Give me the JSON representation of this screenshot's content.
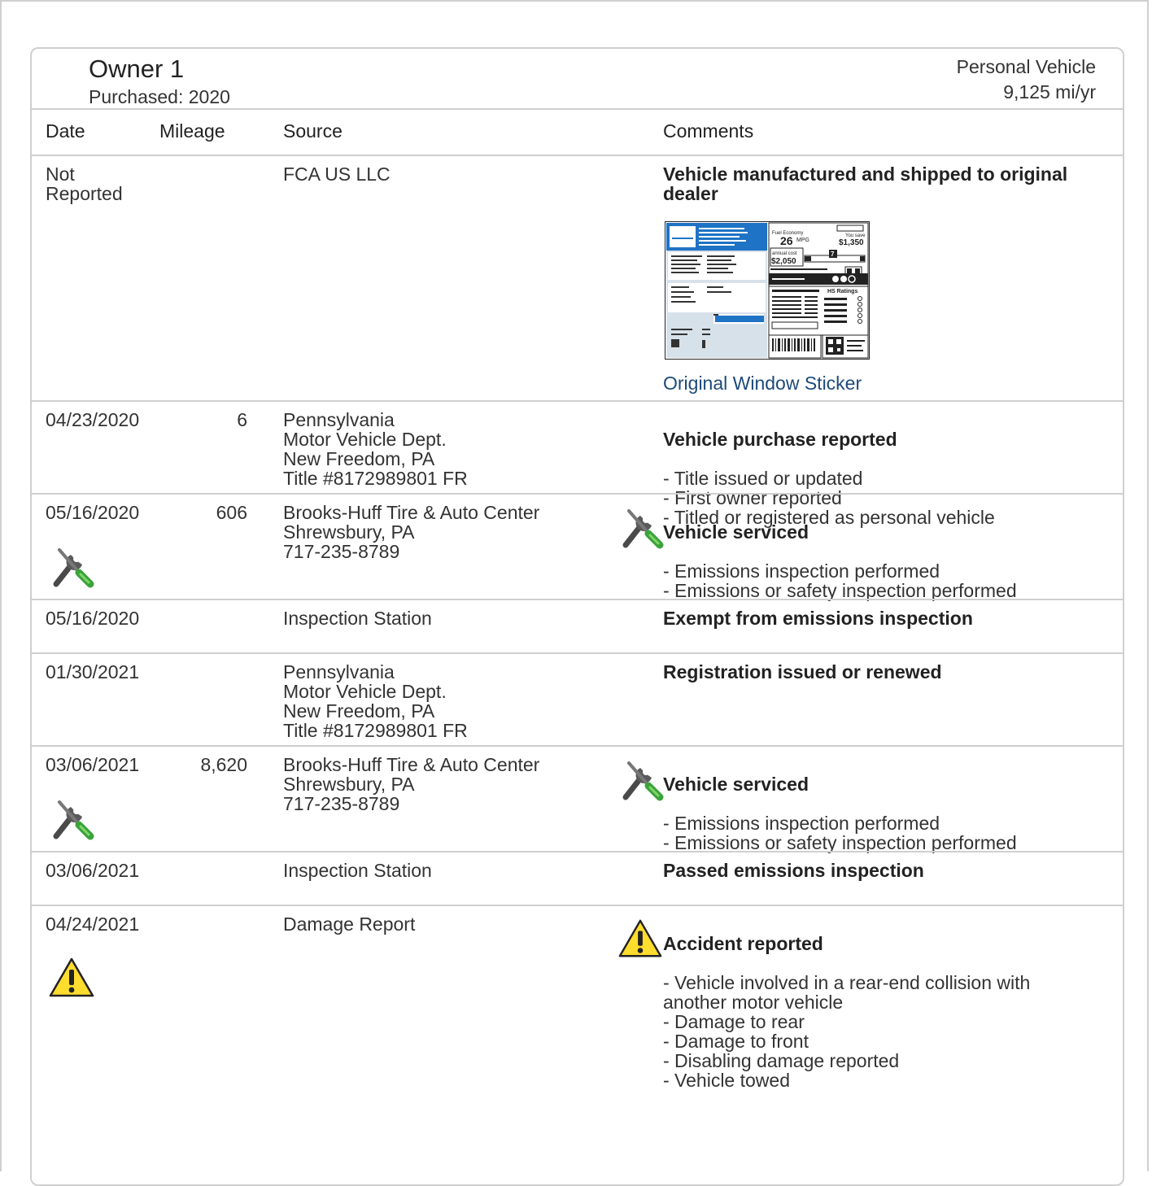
{
  "owner": {
    "title": "Owner 1",
    "purchased": "Purchased: 2020",
    "vehicle_type": "Personal Vehicle",
    "mileage_per_year": "9,125 mi/yr"
  },
  "columns": {
    "date": "Date",
    "mileage": "Mileage",
    "source": "Source",
    "comments": "Comments"
  },
  "sticker": {
    "link_label": "Original Window Sticker",
    "mpg": "26",
    "mpg_unit": "MPG",
    "you_save_label": "You save",
    "save_amount": "$1,350",
    "annual_cost_label": "annual cost",
    "annual_cost": "$2,050",
    "score": "7",
    "ratings_label": "HS Ratings"
  },
  "rows": [
    {
      "date": "Not\nReported",
      "mileage": "",
      "source": "FCA US LLC",
      "comment_title": "Vehicle manufactured and shipped to original dealer",
      "comment_lines": ""
    },
    {
      "date": "04/23/2020",
      "mileage": "6",
      "source": "Pennsylvania\nMotor Vehicle Dept.\nNew Freedom, PA\nTitle #8172989801 FR",
      "comment_title": "Vehicle purchase reported",
      "comment_lines": "- Title issued or updated\n- First owner reported\n- Titled or registered as personal vehicle"
    },
    {
      "date": "05/16/2020",
      "mileage": "606",
      "source": "Brooks-Huff Tire & Auto Center\nShrewsbury, PA\n717-235-8789",
      "comment_title": "Vehicle serviced",
      "comment_lines": "- Emissions inspection performed\n- Emissions or safety inspection performed"
    },
    {
      "date": "05/16/2020",
      "mileage": "",
      "source": "Inspection Station",
      "comment_title": "Exempt from emissions inspection",
      "comment_lines": ""
    },
    {
      "date": "01/30/2021",
      "mileage": "",
      "source": "Pennsylvania\nMotor Vehicle Dept.\nNew Freedom, PA\nTitle #8172989801 FR",
      "comment_title": "Registration issued or renewed",
      "comment_lines": ""
    },
    {
      "date": "03/06/2021",
      "mileage": "8,620",
      "source": "Brooks-Huff Tire & Auto Center\nShrewsbury, PA\n717-235-8789",
      "comment_title": "Vehicle serviced",
      "comment_lines": "- Emissions inspection performed\n- Emissions or safety inspection performed"
    },
    {
      "date": "03/06/2021",
      "mileage": "",
      "source": "Inspection Station",
      "comment_title": "Passed emissions inspection",
      "comment_lines": ""
    },
    {
      "date": "04/24/2021",
      "mileage": "",
      "source": "Damage Report",
      "comment_title": "Accident reported",
      "comment_lines": "- Vehicle involved in a rear-end collision with\n   another motor vehicle\n- Damage to rear\n- Damage to front\n- Disabling damage reported\n- Vehicle towed"
    }
  ],
  "icons": {
    "service": "wrench-screwdriver-icon",
    "accident": "warning-triangle-icon"
  }
}
